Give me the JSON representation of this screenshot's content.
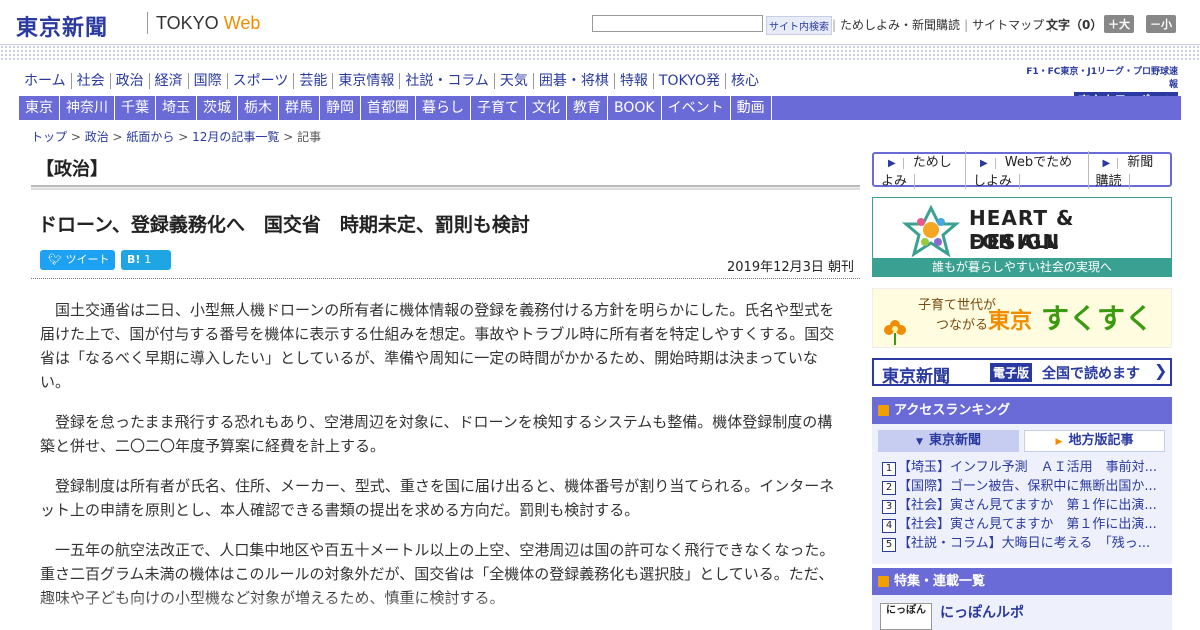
{
  "header": {
    "logo": "東京新聞",
    "logo_sub": "TOKYO",
    "logo_web": "Web",
    "search_button": "サイト内検索",
    "links": [
      "ためしよみ・新聞購読",
      "サイトマップ"
    ],
    "font_label": "文字（0）",
    "font_bigger": "＋大",
    "font_smaller": "－小"
  },
  "main_nav": [
    "ホーム",
    "社会",
    "政治",
    "経済",
    "国際",
    "スポーツ",
    "芸能",
    "東京情報",
    "社説・コラム",
    "天気",
    "囲碁・将棋",
    "特報",
    "TOKYO発",
    "核心"
  ],
  "chunichi": {
    "line1": "F1・FC東京・J1リーグ・プロ野球速報",
    "line2": "東京中日スポーツ"
  },
  "sub_nav": [
    "東京",
    "神奈川",
    "千葉",
    "埼玉",
    "茨城",
    "栃木",
    "群馬",
    "静岡",
    "首都圏",
    "暮らし",
    "子育て",
    "文化",
    "教育",
    "BOOK",
    "イベント",
    "動画"
  ],
  "breadcrumb": [
    "トップ",
    "政治",
    "紙面から",
    "12月の記事一覧",
    "記事"
  ],
  "section_title": "【政治】",
  "article": {
    "headline": "ドローン、登録義務化へ　国交省　時期未定、罰則も検討",
    "tweet_label": "ツイート",
    "hatena_label": "B!",
    "hatena_count": "1",
    "date": "2019年12月3日 朝刊",
    "paragraphs": [
      "国土交通省は二日、小型無人機ドローンの所有者に機体情報の登録を義務付ける方針を明らかにした。氏名や型式を届けた上で、国が付与する番号を機体に表示する仕組みを想定。事故やトラブル時に所有者を特定しやすくする。国交省は「なるべく早期に導入したい」としているが、準備や周知に一定の時間がかかるため、開始時期は決まっていない。",
      "登録を怠ったまま飛行する恐れもあり、空港周辺を対象に、ドローンを検知するシステムも整備。機体登録制度の構築と併せ、二〇二〇年度予算案に経費を計上する。",
      "登録制度は所有者が氏名、住所、メーカー、型式、重さを国に届け出ると、機体番号が割り当てられる。インターネット上の申請を原則とし、本人確認できる書類の提出を求める方向だ。罰則も検討する。",
      "一五年の航空法改正で、人口集中地区や百五十メートル以上の上空、空港周辺は国の許可なく飛行できなくなった。重さ二百グラム未満の機体はこのルールの対象外だが、国交省は「全機体の登録義務化も選択肢」としている。ただ、趣味や子ども向けの小型機など対象が増えるため、慎重に検討する。"
    ]
  },
  "sidebar": {
    "links": [
      "ためしよみ",
      "Webでためしよみ",
      "新聞購読"
    ],
    "heart": {
      "line1": "HEART & DESIGN",
      "line2": "FOR ALL",
      "caption": "誰もが暮らしやすい社会の実現へ"
    },
    "sukusuku": {
      "line1": "子育て世代が",
      "line2": "つながる",
      "city": "東京",
      "main": "すくすく"
    },
    "denshi": {
      "logo": "東京新聞",
      "badge": "電子版",
      "text": "全国で読めます"
    },
    "ranking": {
      "title": "アクセスランキング",
      "tab_local": "東京新聞",
      "tab_regional": "地方版記事",
      "items": [
        {
          "num": "1",
          "text": "【埼玉】インフル予測　ＡＩ活用　事前対..."
        },
        {
          "num": "2",
          "text": "【国際】ゴーン被告、保釈中に無断出国か..."
        },
        {
          "num": "3",
          "text": "【社会】寅さん見てますか　第１作に出演..."
        },
        {
          "num": "4",
          "text": "【社会】寅さん見てますか　第１作に出演..."
        },
        {
          "num": "5",
          "text": "【社説・コラム】大晦日に考える　「残っ..."
        }
      ]
    },
    "features": {
      "title": "特集・連載一覧",
      "item_img": "にっぽん",
      "item_title": "にっぽんルポ"
    }
  }
}
